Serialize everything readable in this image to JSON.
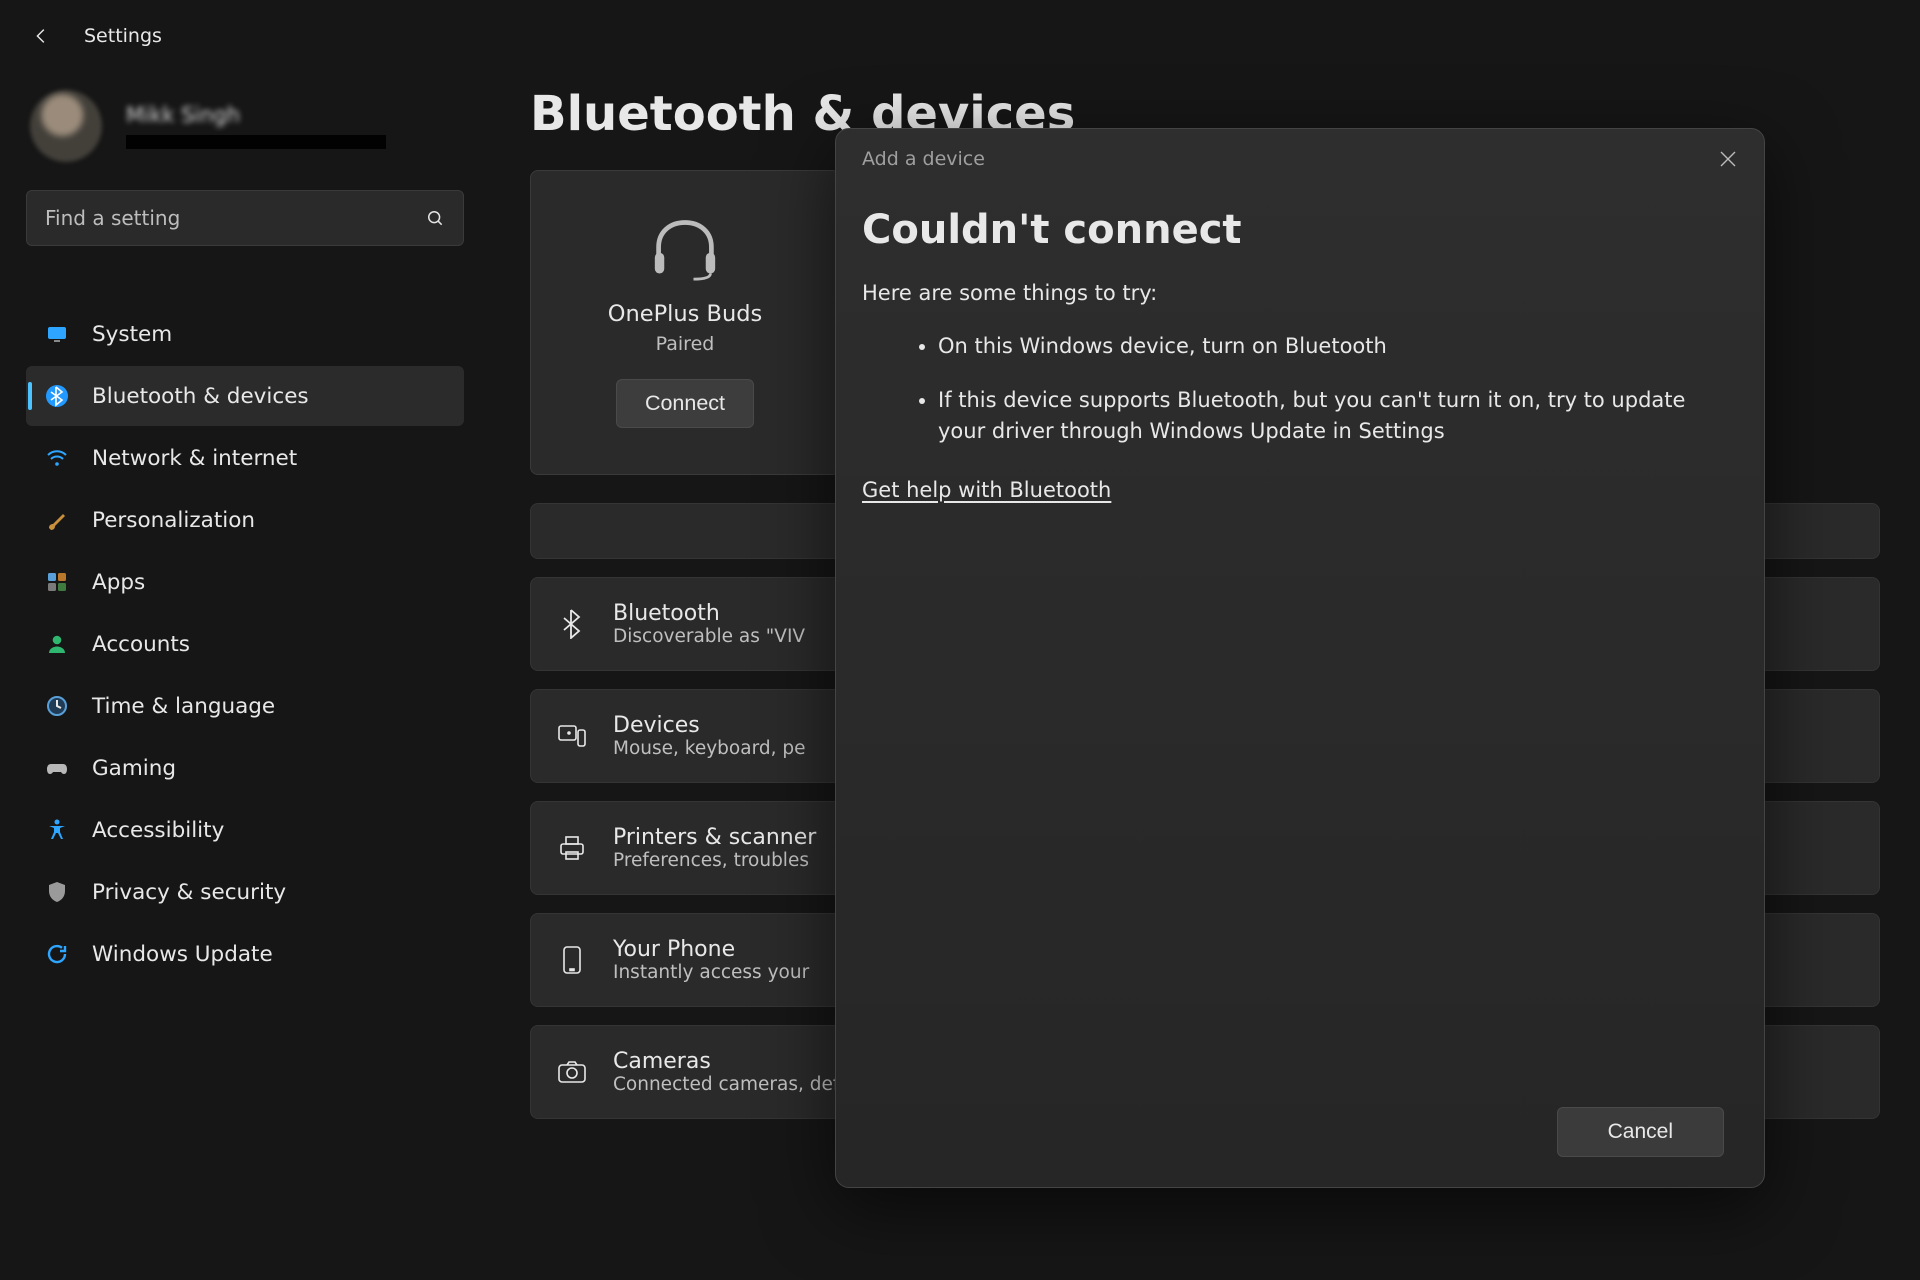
{
  "app": {
    "title": "Settings"
  },
  "profile": {
    "name": "Mikk Singh"
  },
  "search": {
    "placeholder": "Find a setting"
  },
  "nav": {
    "items": [
      {
        "id": "system",
        "label": "System"
      },
      {
        "id": "bluetooth",
        "label": "Bluetooth & devices",
        "active": true
      },
      {
        "id": "network",
        "label": "Network & internet"
      },
      {
        "id": "personalization",
        "label": "Personalization"
      },
      {
        "id": "apps",
        "label": "Apps"
      },
      {
        "id": "accounts",
        "label": "Accounts"
      },
      {
        "id": "time",
        "label": "Time & language"
      },
      {
        "id": "gaming",
        "label": "Gaming"
      },
      {
        "id": "accessibility",
        "label": "Accessibility"
      },
      {
        "id": "privacy",
        "label": "Privacy & security"
      },
      {
        "id": "update",
        "label": "Windows Update"
      }
    ]
  },
  "page": {
    "title": "Bluetooth & devices",
    "device_card": {
      "name": "OnePlus Buds",
      "status": "Paired",
      "action": "Connect"
    },
    "rows": [
      {
        "id": "bluetooth",
        "title": "Bluetooth",
        "sub": "Discoverable as \"VIV"
      },
      {
        "id": "devices",
        "title": "Devices",
        "sub": "Mouse, keyboard, pe"
      },
      {
        "id": "printers",
        "title": "Printers & scanner",
        "sub": "Preferences, troubles"
      },
      {
        "id": "phone",
        "title": "Your Phone",
        "sub": "Instantly access your"
      },
      {
        "id": "cameras",
        "title": "Cameras",
        "sub": "Connected cameras, default image settings"
      }
    ]
  },
  "modal": {
    "crumb": "Add a device",
    "title": "Couldn't connect",
    "intro": "Here are some things to try:",
    "tips": [
      "On this Windows device, turn on Bluetooth",
      "If this device supports Bluetooth, but you can't turn it on, try to update your driver through Windows Update in Settings"
    ],
    "help_link": "Get help with Bluetooth",
    "cancel": "Cancel"
  }
}
